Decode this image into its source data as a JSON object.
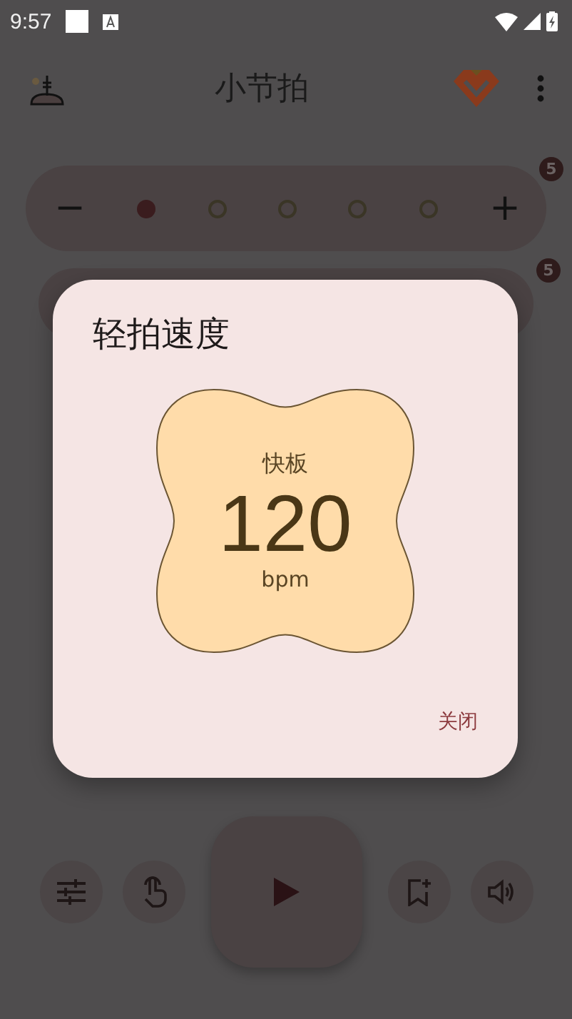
{
  "status_bar": {
    "time": "9:57"
  },
  "app_bar": {
    "title": "小节拍"
  },
  "beat_row": {
    "badge": "5",
    "minus": "−",
    "plus": "+",
    "beats": [
      {
        "accented": true
      },
      {
        "accented": false
      },
      {
        "accented": false
      },
      {
        "accented": false
      },
      {
        "accented": false
      }
    ]
  },
  "second_row": {
    "badge": "5"
  },
  "dialog": {
    "title": "轻拍速度",
    "tempo_name": "快板",
    "bpm": "120",
    "unit": "bpm",
    "close_button": "关闭"
  }
}
